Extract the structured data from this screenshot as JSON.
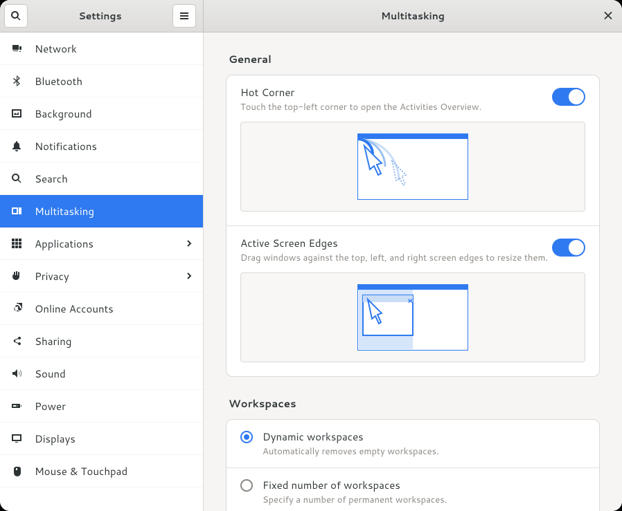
{
  "header": {
    "sidebar_title": "Settings",
    "content_title": "Multitasking"
  },
  "sidebar": {
    "items": [
      {
        "label": "Network"
      },
      {
        "label": "Bluetooth"
      },
      {
        "label": "Background"
      },
      {
        "label": "Notifications"
      },
      {
        "label": "Search"
      },
      {
        "label": "Multitasking"
      },
      {
        "label": "Applications"
      },
      {
        "label": "Privacy"
      },
      {
        "label": "Online Accounts"
      },
      {
        "label": "Sharing"
      },
      {
        "label": "Sound"
      },
      {
        "label": "Power"
      },
      {
        "label": "Displays"
      },
      {
        "label": "Mouse & Touchpad"
      }
    ]
  },
  "sections": {
    "general": {
      "label": "General",
      "hot_corner": {
        "title": "Hot Corner",
        "desc": "Touch the top-left corner to open the Activities Overview.",
        "enabled": true
      },
      "active_edges": {
        "title": "Active Screen Edges",
        "desc": "Drag windows against the top, left, and right screen edges to resize them.",
        "enabled": true
      }
    },
    "workspaces": {
      "label": "Workspaces",
      "dynamic": {
        "title": "Dynamic workspaces",
        "desc": "Automatically removes empty workspaces.",
        "selected": true
      },
      "fixed": {
        "title": "Fixed number of workspaces",
        "desc": "Specify a number of permanent workspaces.",
        "selected": false
      }
    }
  }
}
